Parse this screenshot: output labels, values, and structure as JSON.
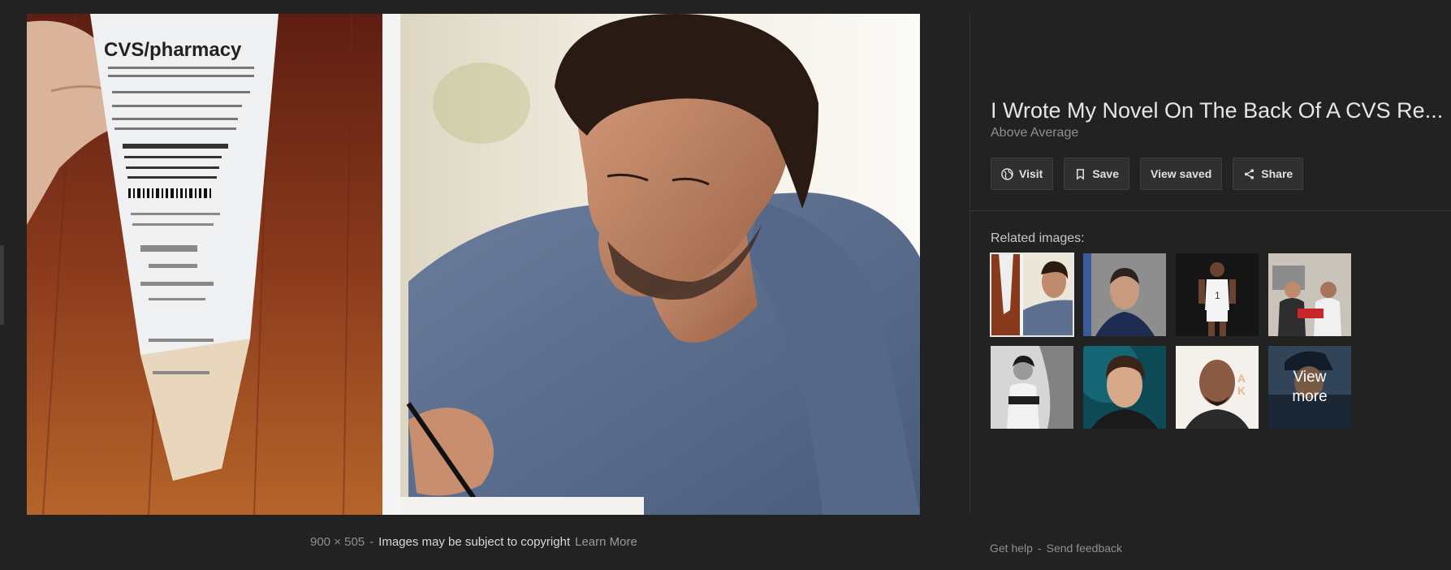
{
  "preview": {
    "receipt_brand": "CVS/pharmacy",
    "size": "900 × 505",
    "copyright": "Images may be subject to copyright",
    "learn_more": "Learn More"
  },
  "panel": {
    "title": "I Wrote My Novel On The Back Of A CVS Re...",
    "source": "Above Average",
    "actions": [
      {
        "label": "Visit",
        "icon": "globe-icon"
      },
      {
        "label": "Save",
        "icon": "bookmark-icon"
      },
      {
        "label": "View saved",
        "icon": ""
      },
      {
        "label": "Share",
        "icon": "share-icon"
      }
    ],
    "related_label": "Related images:",
    "view_more_line1": "View",
    "view_more_line2": "more"
  },
  "footer": {
    "help": "Get help",
    "feedback": "Send feedback"
  },
  "colors": {
    "background": "#222222",
    "button_bg": "#303030",
    "muted_text": "#8f8f8f"
  }
}
